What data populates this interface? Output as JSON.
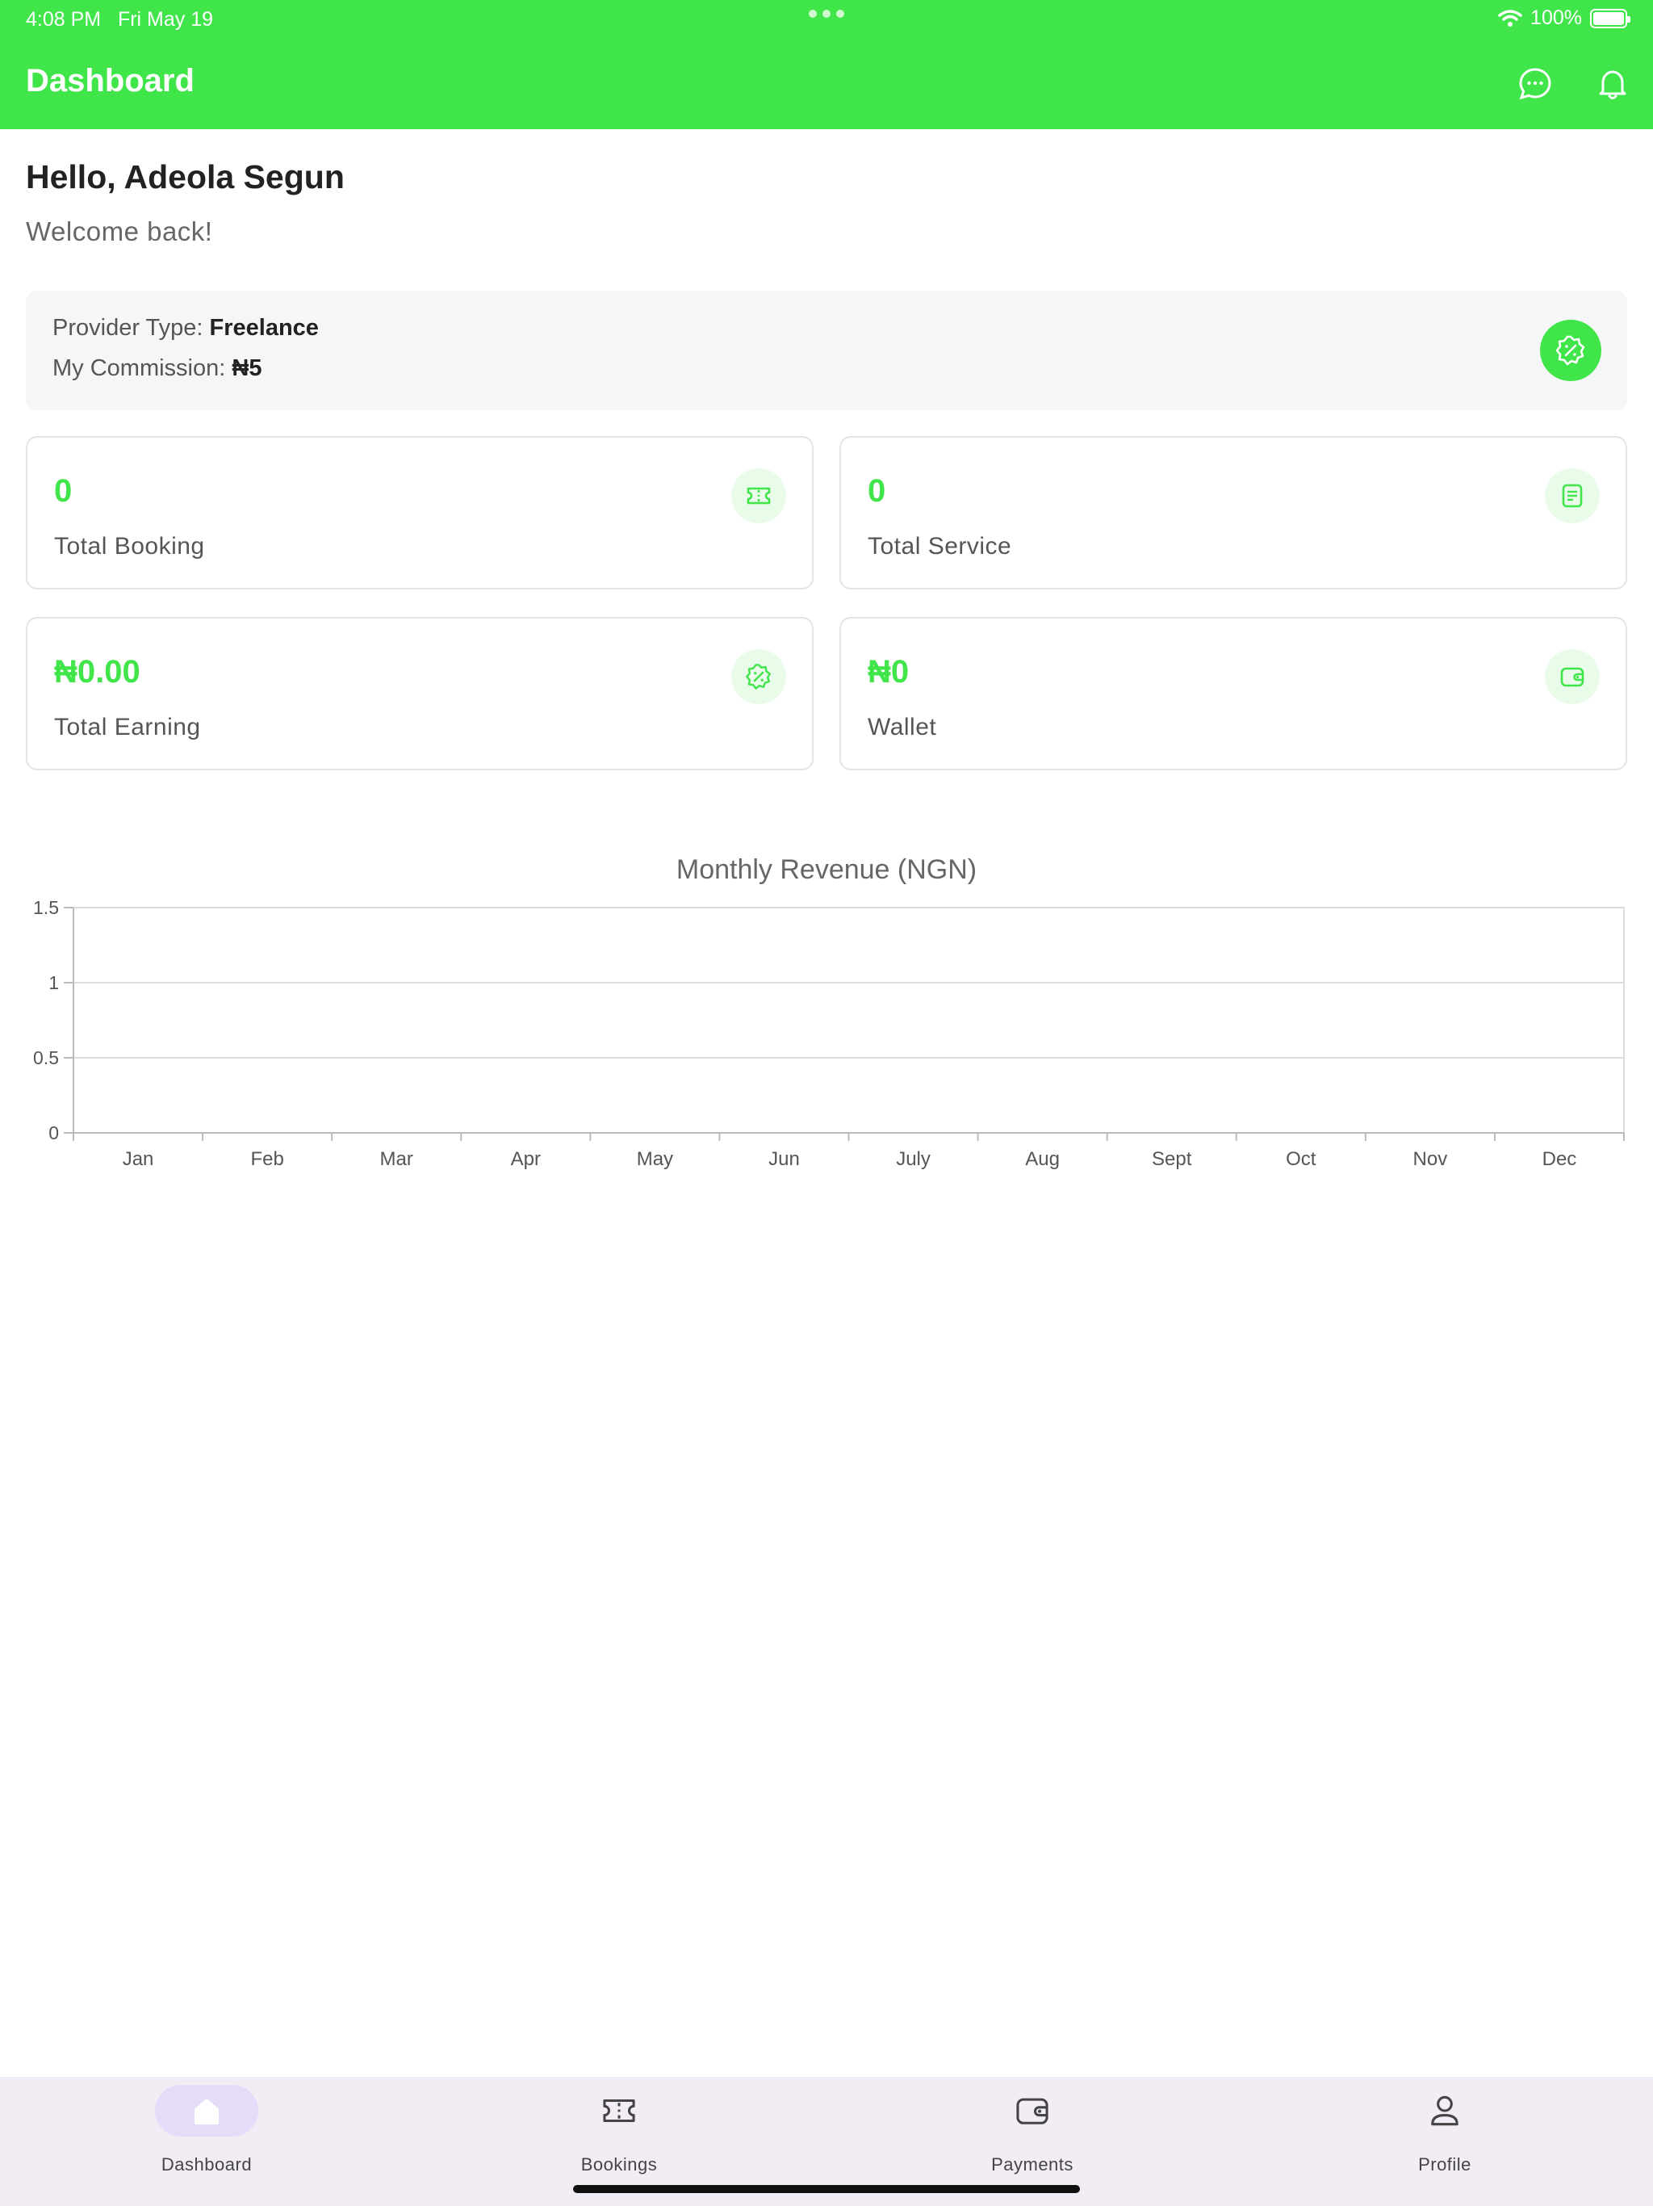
{
  "status_bar": {
    "time": "4:08 PM",
    "date": "Fri May 19",
    "battery": "100%"
  },
  "header": {
    "title": "Dashboard",
    "icons": [
      "chat-icon",
      "bell-icon"
    ]
  },
  "greeting": {
    "hello": "Hello, Adeola Segun",
    "welcome": "Welcome back!"
  },
  "provider": {
    "type_label": "Provider Type:",
    "type_value": "Freelance",
    "commission_label": "My Commission:",
    "commission_value": "₦5",
    "icon": "discount-badge-icon"
  },
  "stats": [
    {
      "value": "0",
      "label": "Total Booking",
      "icon": "ticket-icon"
    },
    {
      "value": "0",
      "label": "Total Service",
      "icon": "document-list-icon"
    },
    {
      "value": "₦0.00",
      "label": "Total Earning",
      "icon": "discount-badge-icon"
    },
    {
      "value": "₦0",
      "label": "Wallet",
      "icon": "wallet-icon"
    }
  ],
  "colors": {
    "brand": "#40e54a",
    "nav_bg": "#f2ecf5",
    "nav_active": "#e6dbf8"
  },
  "chart_data": {
    "type": "line",
    "title": "Monthly Revenue (NGN)",
    "categories": [
      "Jan",
      "Feb",
      "Mar",
      "Apr",
      "May",
      "Jun",
      "July",
      "Aug",
      "Sept",
      "Oct",
      "Nov",
      "Dec"
    ],
    "series": [
      {
        "values": []
      }
    ],
    "ylim": [
      0,
      1.5
    ],
    "yticks": [
      "0",
      "0.5",
      "1",
      "1.5"
    ],
    "grid": true,
    "xlabel": "",
    "ylabel": ""
  },
  "bottom_nav": {
    "items": [
      {
        "label": "Dashboard",
        "icon": "home-icon",
        "active": true
      },
      {
        "label": "Bookings",
        "icon": "ticket-icon",
        "active": false
      },
      {
        "label": "Payments",
        "icon": "wallet-icon",
        "active": false
      },
      {
        "label": "Profile",
        "icon": "user-icon",
        "active": false
      }
    ]
  }
}
